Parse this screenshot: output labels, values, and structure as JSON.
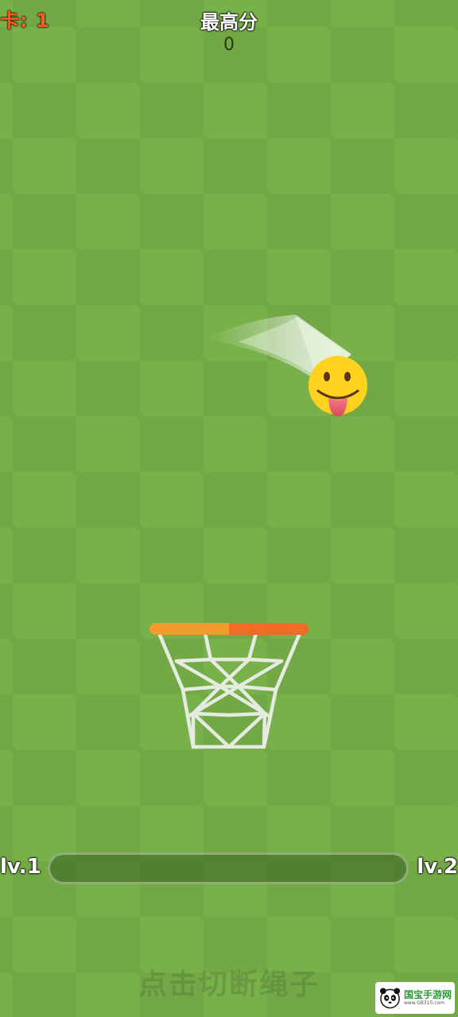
{
  "hud": {
    "level_label": "卡: 1",
    "high_score_label": "最高分",
    "high_score_value": "0"
  },
  "progress": {
    "left_label": "lv.1",
    "right_label": "lv.2",
    "fraction": 0
  },
  "hint": "点击切断绳子",
  "characters": {
    "ball": "tongue-out-emoji",
    "hoop": "basketball-hoop"
  },
  "colors": {
    "background": "#78b04a",
    "rim_left": "#f39b2d",
    "rim_right": "#f26a25",
    "ball": "#ffd21f"
  },
  "watermark": {
    "brand": "国宝手游网",
    "url": "www.GB315.com"
  }
}
